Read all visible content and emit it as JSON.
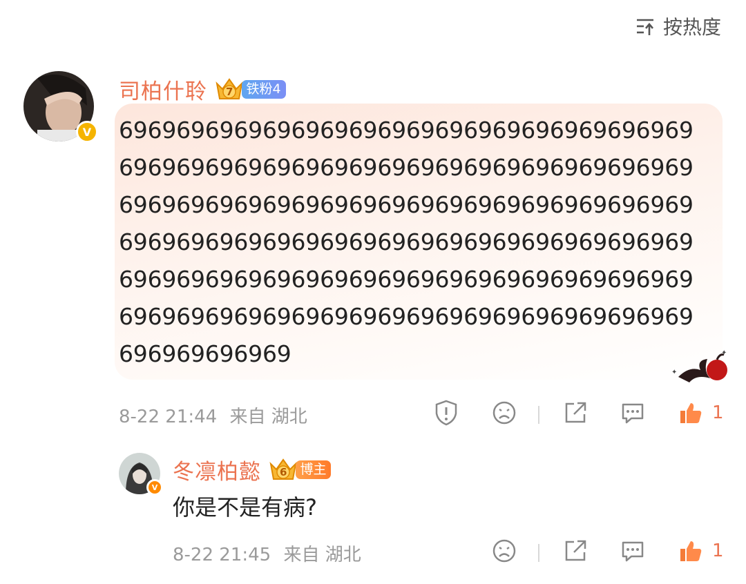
{
  "sort": {
    "label": "按热度",
    "icon": "sort-icon"
  },
  "comment": {
    "username": "司柏什聆",
    "badge_level": "7",
    "fan_badge": "铁粉4",
    "verified": true,
    "text": "696969696969696969696969696969696969696969696969696969696969696969696969696969696969696969696969696969696969696969696969696969696969696969696969696969696969696969696969696969696969696969696969696969696969696969696969696969696969696969696969696969696969",
    "time": "8-22 21:44",
    "source": "来自 湖北",
    "like_count": "1",
    "icons": [
      "report-icon",
      "frown-icon",
      "share-icon",
      "comment-icon",
      "like-icon"
    ]
  },
  "reply": {
    "username": "冬凛柏懿",
    "badge_level": "6",
    "role_badge": "博主",
    "verified": true,
    "text": "你是不是有病?",
    "time": "8-22 21:45",
    "source": "来自 湖北",
    "like_count": "1",
    "icons": [
      "frown-icon",
      "share-icon",
      "comment-icon",
      "like-icon"
    ]
  },
  "colors": {
    "username": "#eb7350",
    "like": "#eb7350",
    "meta": "#9a9a9a",
    "verified": "#f5b400"
  }
}
